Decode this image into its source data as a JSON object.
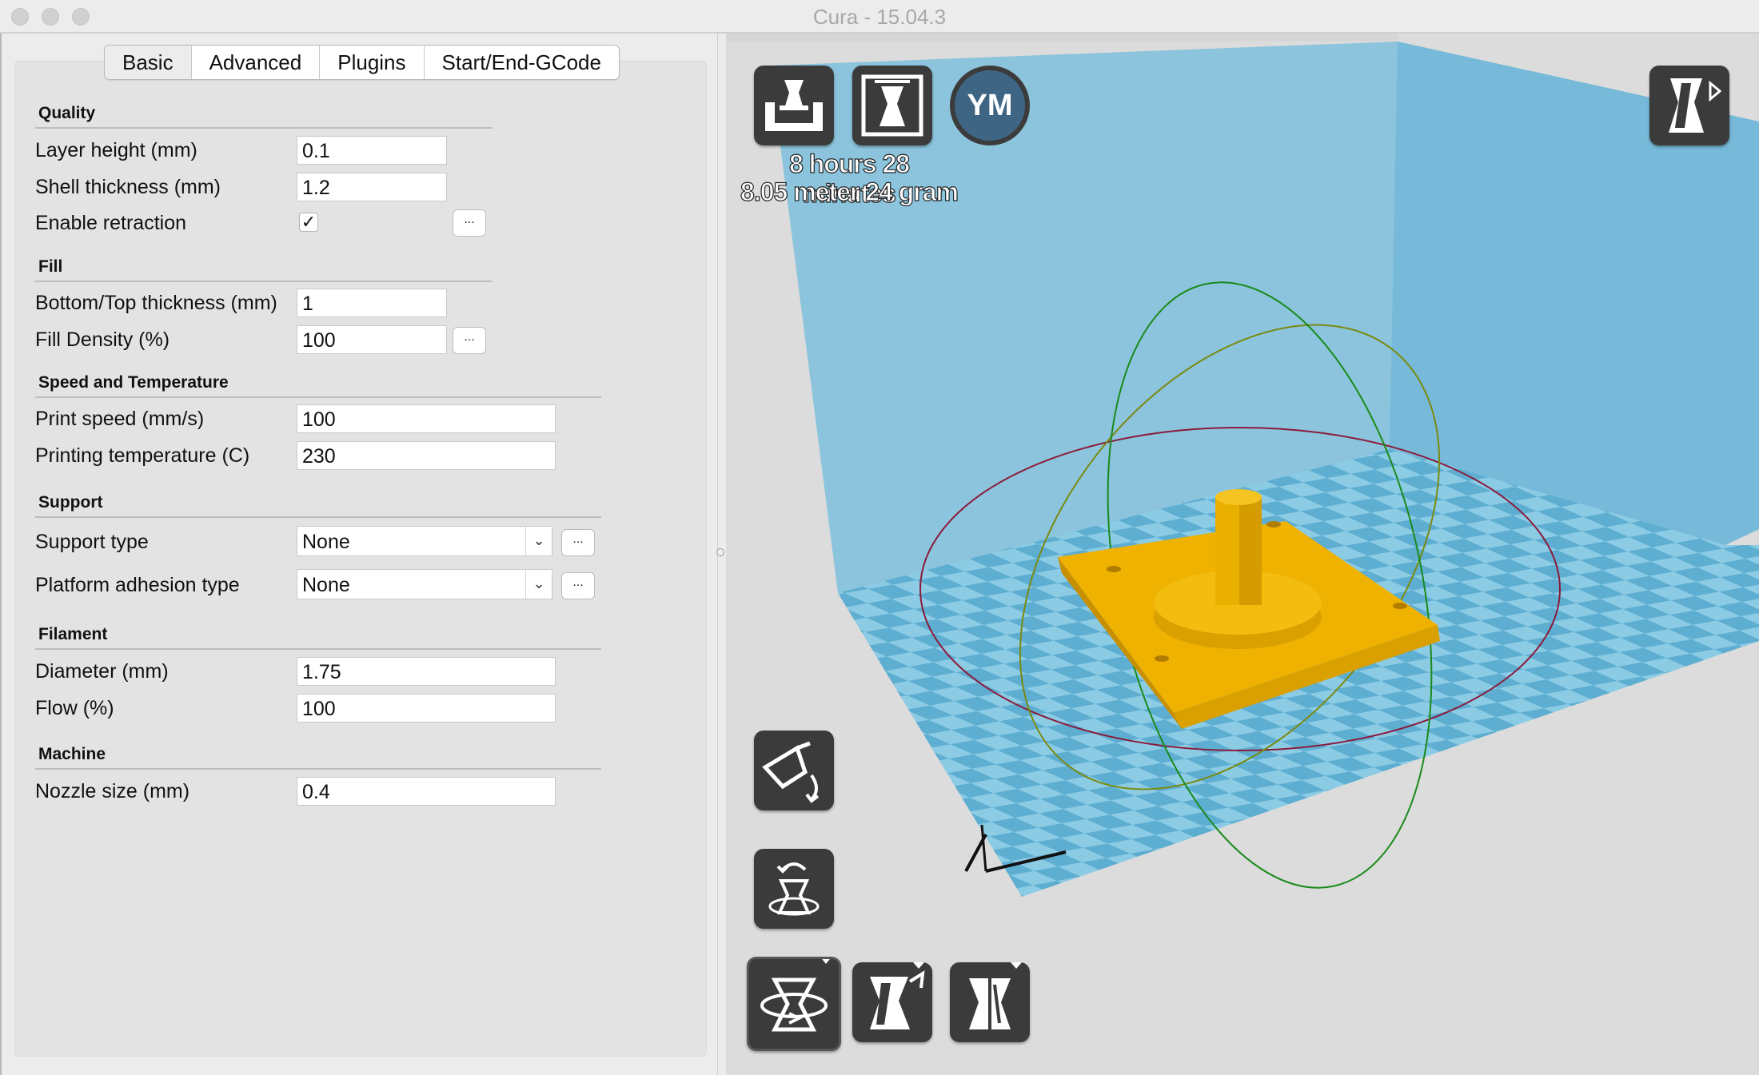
{
  "window": {
    "title": "Cura - 15.04.3"
  },
  "tabs": [
    "Basic",
    "Advanced",
    "Plugins",
    "Start/End-GCode"
  ],
  "sections": {
    "quality": {
      "title": "Quality",
      "layer_height": {
        "label": "Layer height (mm)",
        "value": "0.1"
      },
      "shell_thickness": {
        "label": "Shell thickness (mm)",
        "value": "1.2"
      },
      "enable_retraction": {
        "label": "Enable retraction",
        "checked": true,
        "mark": "✓"
      }
    },
    "fill": {
      "title": "Fill",
      "bottom_top": {
        "label": "Bottom/Top thickness (mm)",
        "value": "1"
      },
      "fill_density": {
        "label": "Fill Density (%)",
        "value": "100"
      }
    },
    "speed": {
      "title": "Speed and Temperature",
      "print_speed": {
        "label": "Print speed (mm/s)",
        "value": "100"
      },
      "print_temp": {
        "label": "Printing temperature (C)",
        "value": "230"
      }
    },
    "support": {
      "title": "Support",
      "support_type": {
        "label": "Support type",
        "value": "None"
      },
      "adhesion_type": {
        "label": "Platform adhesion type",
        "value": "None"
      }
    },
    "filament": {
      "title": "Filament",
      "diameter": {
        "label": "Diameter (mm)",
        "value": "1.75"
      },
      "flow": {
        "label": "Flow (%)",
        "value": "100"
      }
    },
    "machine": {
      "title": "Machine",
      "nozzle": {
        "label": "Nozzle size (mm)",
        "value": "0.4"
      }
    }
  },
  "buttons": {
    "ellipsis": "...",
    "dropdown_caret": "⌄"
  },
  "viewport": {
    "estimate_time": "8 hours 28 minutes",
    "estimate_material": "8.05 meter 24 gram",
    "ym_badge": "YM",
    "colors": {
      "build_volume": "#7cc0dc",
      "model": "#f0b200",
      "platform_light": "#8ccbe4",
      "platform_dark": "#5eaed2"
    }
  }
}
